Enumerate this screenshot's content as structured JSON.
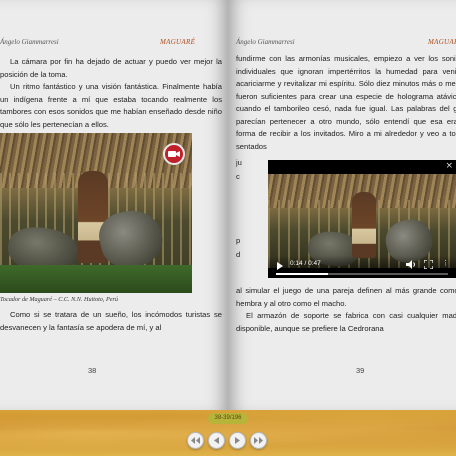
{
  "left_page": {
    "running_author": "Ángelo Giammarresi",
    "running_title": "MAGUARÉ",
    "paragraphs_top": [
      "La cámara por fin ha dejado de actuar y puedo ver mejor la posición de la toma.",
      "Un ritmo fantástico y una visión fantástica. Finalmente había un indígena frente a mí que estaba tocando realmente los tambores con esos sonidos que me habían enseñado desde niño que sólo les pertenecían a ellos."
    ],
    "caption": "Tocador de Maguaré – C.C. N.N. Huitoto, Perú",
    "paragraph_bottom": "Como si se tratara de un sueño, los incómodos turistas se desvanecen y la fantasía se apodera de mí, y al",
    "page_number": "38"
  },
  "right_page": {
    "running_author": "Ángelo Giammarresi",
    "running_title": "MAGUARÉ",
    "paragraph_top": "fundirme con las armonías musicales, empiezo a ver los sonidos individuales que ignoran impertérritos la humedad para venir a acariciarme y revitalizar mi espíritu. Sólo diez minutos más o menos fueron suficientes para crear una especie de holograma atávico y cuando el tamborileo cesó, nada fue igual. Las palabras del guía parecían pertenecer a otro mundo, sólo entendí que esa era la forma de recibir a los invitados. Miro a mi alrededor y veo a todos sentados",
    "side_fragments": [
      "ju",
      "c",
      "p",
      "d"
    ],
    "paragraphs_bottom": [
      "al simular el juego de una pareja definen al más grande como la hembra y al otro como el macho.",
      "El armazón de soporte se fabrica con casi cualquier madera disponible, aunque se prefiere la Cedrorana"
    ],
    "page_number": "39"
  },
  "video": {
    "close_label": "×",
    "time": "0:14 / 0:47",
    "progress": 0.3,
    "icons": [
      "play-icon",
      "volume-icon",
      "fullscreen-icon",
      "more-options-icon"
    ]
  },
  "bottom_bar": {
    "page_indicator": "38-39/196",
    "buttons": [
      "first-page",
      "previous-page",
      "next-page",
      "last-page"
    ]
  },
  "colors": {
    "running_title": "#b04a1a",
    "camera_badge": "#c0202a",
    "bottom_bar": "#d9a33a"
  }
}
